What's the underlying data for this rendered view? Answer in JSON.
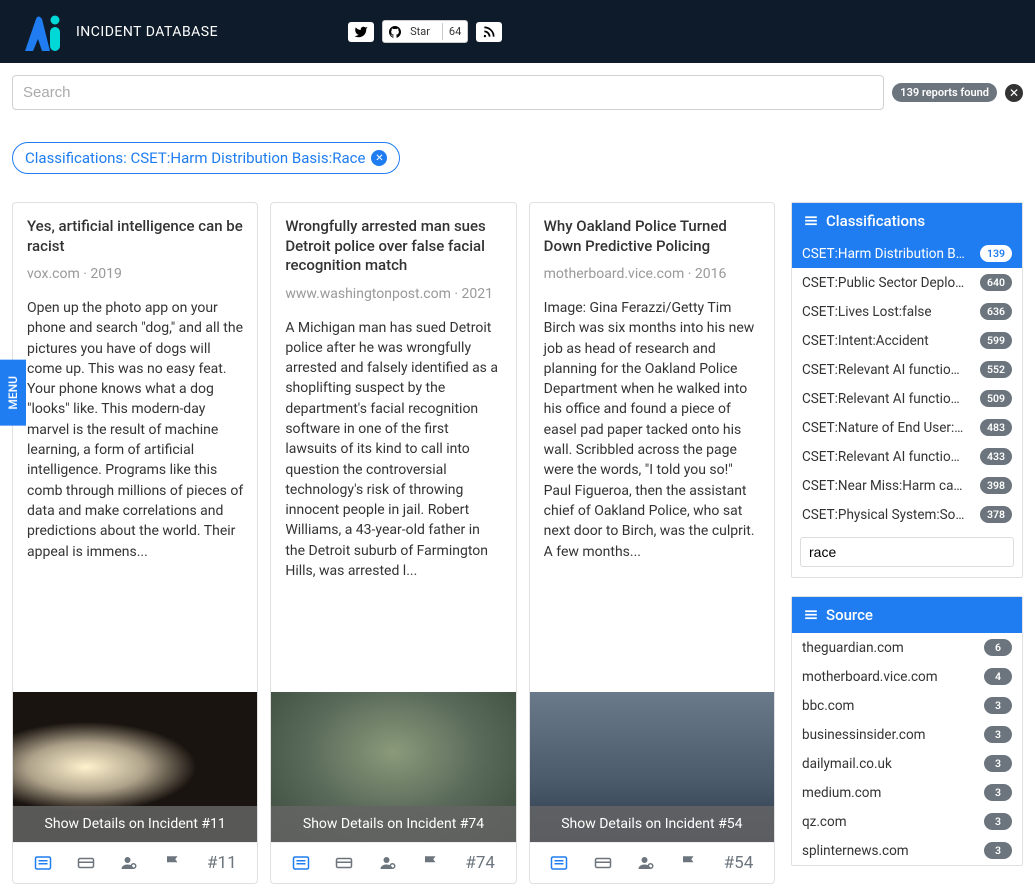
{
  "header": {
    "brand": "INCIDENT DATABASE",
    "github_star": "Star",
    "github_count": "64"
  },
  "menu_label": "MENU",
  "search": {
    "placeholder": "Search",
    "reports_found": "139 reports found"
  },
  "filter_chip": "Classifications: CSET:Harm Distribution Basis:Race",
  "cards": [
    {
      "title": "Yes, artificial intelligence can be racist",
      "source": "vox.com",
      "year": "2019",
      "text": "Open up the photo app on your phone and search \"dog,\" and all the pictures you have of dogs will come up. This was no easy feat. Your phone knows what a dog \"looks\" like. This modern-day marvel is the result of machine learning, a form of artificial intelligence. Programs like this comb through millions of pieces of data and make correlations and predictions about the world. Their appeal is immens...",
      "overlay": "Show Details on Incident #11",
      "hash": "#11"
    },
    {
      "title": "Wrongfully arrested man sues Detroit police over false facial recognition match",
      "source": "www.washingtonpost.com",
      "year": "2021",
      "text": "A Michigan man has sued Detroit police after he was wrongfully arrested and falsely identified as a shoplifting suspect by the department's facial recognition software in one of the first lawsuits of its kind to call into question the controversial technology's risk of throwing innocent people in jail. Robert Williams, a 43-year-old father in the Detroit suburb of Farmington Hills, was arrested l...",
      "overlay": "Show Details on Incident #74",
      "hash": "#74"
    },
    {
      "title": "Why Oakland Police Turned Down Predictive Policing",
      "source": "motherboard.vice.com",
      "year": "2016",
      "text": "Image: Gina Ferazzi/Getty Tim Birch was six months into his new job as head of research and planning for the Oakland Police Department when he walked into his office and found a piece of easel pad paper tacked onto his wall. Scribbled across the page were the words, \"I told you so!\" Paul Figueroa, then the assistant chief of Oakland Police, who sat next door to Birch, was the culprit. A few months...",
      "overlay": "Show Details on Incident #54",
      "hash": "#54"
    }
  ],
  "sidebar": {
    "classifications": {
      "title": "Classifications",
      "search_value": "race",
      "items": [
        {
          "label": "CSET:Harm Distribution Basis:Race",
          "count": "139",
          "selected": true
        },
        {
          "label": "CSET:Public Sector Deployment:No",
          "count": "640"
        },
        {
          "label": "CSET:Lives Lost:false",
          "count": "636"
        },
        {
          "label": "CSET:Intent:Accident",
          "count": "599"
        },
        {
          "label": "CSET:Relevant AI functions:Cognition",
          "count": "552"
        },
        {
          "label": "CSET:Relevant AI functions:Perception",
          "count": "509"
        },
        {
          "label": "CSET:Nature of End User:Amateur",
          "count": "483"
        },
        {
          "label": "CSET:Relevant AI functions:Action",
          "count": "433"
        },
        {
          "label": "CSET:Near Miss:Harm caused",
          "count": "398"
        },
        {
          "label": "CSET:Physical System:Software only",
          "count": "378"
        }
      ]
    },
    "source": {
      "title": "Source",
      "items": [
        {
          "label": "theguardian.com",
          "count": "6"
        },
        {
          "label": "motherboard.vice.com",
          "count": "4"
        },
        {
          "label": "bbc.com",
          "count": "3"
        },
        {
          "label": "businessinsider.com",
          "count": "3"
        },
        {
          "label": "dailymail.co.uk",
          "count": "3"
        },
        {
          "label": "medium.com",
          "count": "3"
        },
        {
          "label": "qz.com",
          "count": "3"
        },
        {
          "label": "splinternews.com",
          "count": "3"
        }
      ]
    }
  }
}
